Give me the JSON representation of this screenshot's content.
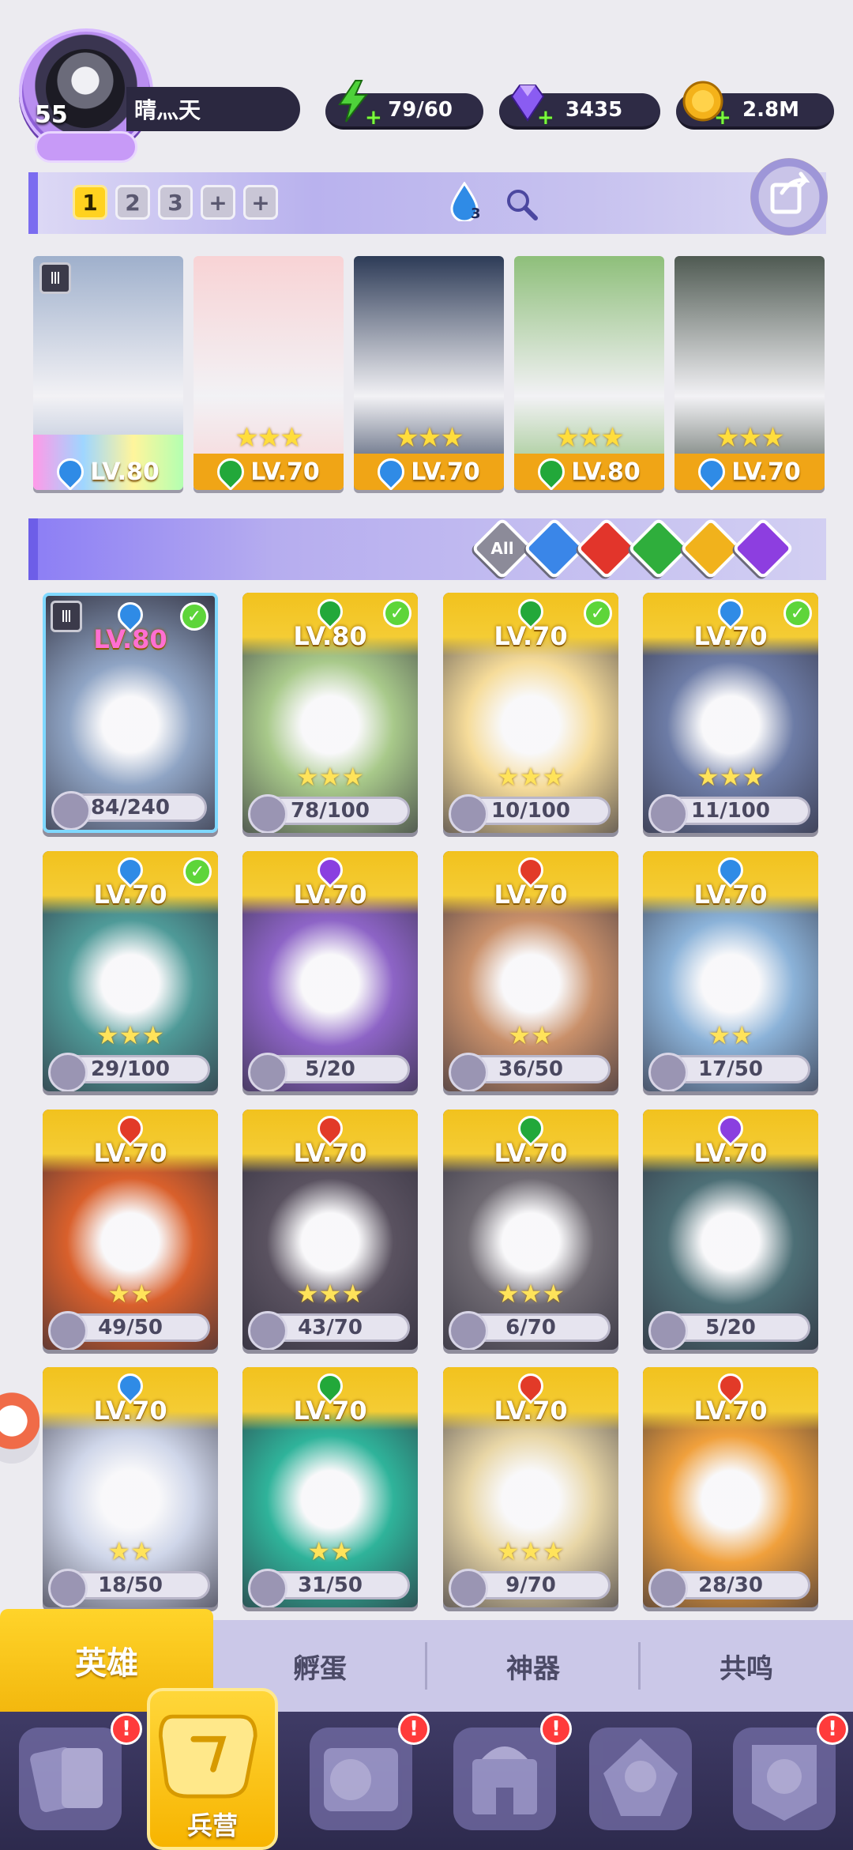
{
  "player": {
    "level": "55",
    "name": "晴灬天"
  },
  "resources": [
    {
      "name": "stamina",
      "value": "79/60",
      "icon": "lightning-icon",
      "color": "#4ed23a"
    },
    {
      "name": "gems",
      "value": "3435",
      "icon": "gem-icon",
      "color": "#8a5cf2"
    },
    {
      "name": "coins",
      "value": "2.8M",
      "icon": "coin-icon",
      "color": "#f4b21a"
    }
  ],
  "team_bar": {
    "tabs": [
      "1",
      "2",
      "3",
      "+",
      "+"
    ],
    "active_tab": "1",
    "water_count": "3"
  },
  "team_slots": [
    {
      "level": "LV.80",
      "element": "water",
      "stars": "",
      "team_mark": "Ⅲ"
    },
    {
      "level": "LV.70",
      "element": "wind",
      "stars": "★★★"
    },
    {
      "level": "LV.70",
      "element": "water",
      "stars": "★★★"
    },
    {
      "level": "LV.80",
      "element": "wind",
      "stars": "★★★"
    },
    {
      "level": "LV.70",
      "element": "water",
      "stars": "★★★"
    }
  ],
  "filters": [
    {
      "label": "All",
      "color": "#8c8b99"
    },
    {
      "label": "",
      "color": "#3a86e8"
    },
    {
      "label": "",
      "color": "#e2352b"
    },
    {
      "label": "",
      "color": "#2fae3c"
    },
    {
      "label": "",
      "color": "#f1b21c"
    },
    {
      "label": "",
      "color": "#8d3ee0"
    }
  ],
  "element_colors": {
    "water": "#2f8be6",
    "wind": "#22a83a",
    "fire": "#e23a28",
    "dark": "#8a3fe0",
    "light": "#f2b31c"
  },
  "heroes": [
    {
      "level": "LV.80",
      "element": "water",
      "shards": "84/240",
      "stars": "",
      "checked": true,
      "team_mark": "Ⅲ",
      "art": "#8fa4c4"
    },
    {
      "level": "LV.80",
      "element": "wind",
      "shards": "78/100",
      "stars": "★★★",
      "checked": true,
      "art": "#a8c98a"
    },
    {
      "level": "LV.70",
      "element": "wind",
      "shards": "10/100",
      "stars": "★★★",
      "checked": true,
      "art": "#f6dc9a"
    },
    {
      "level": "LV.70",
      "element": "water",
      "shards": "11/100",
      "stars": "★★★",
      "checked": true,
      "art": "#6d7ca6"
    },
    {
      "level": "LV.70",
      "element": "water",
      "shards": "29/100",
      "stars": "★★★",
      "checked": true,
      "art": "#4f9a98"
    },
    {
      "level": "LV.70",
      "element": "dark",
      "shards": "5/20",
      "stars": "",
      "checked": false,
      "art": "#8d64c6"
    },
    {
      "level": "LV.70",
      "element": "fire",
      "shards": "36/50",
      "stars": "★★",
      "checked": false,
      "art": "#c9906a"
    },
    {
      "level": "LV.70",
      "element": "water",
      "shards": "17/50",
      "stars": "★★",
      "checked": false,
      "art": "#8bb2d8"
    },
    {
      "level": "LV.70",
      "element": "fire",
      "shards": "49/50",
      "stars": "★★",
      "checked": false,
      "art": "#d9602c"
    },
    {
      "level": "LV.70",
      "element": "fire",
      "shards": "43/70",
      "stars": "★★★",
      "checked": false,
      "art": "#5a5260"
    },
    {
      "level": "LV.70",
      "element": "wind",
      "shards": "6/70",
      "stars": "★★★",
      "checked": false,
      "art": "#6f6a72"
    },
    {
      "level": "LV.70",
      "element": "dark",
      "shards": "5/20",
      "stars": "",
      "checked": false,
      "art": "#4d6f76"
    },
    {
      "level": "LV.70",
      "element": "water",
      "shards": "18/50",
      "stars": "★★",
      "checked": false,
      "art": "#cfd6e9"
    },
    {
      "level": "LV.70",
      "element": "wind",
      "shards": "31/50",
      "stars": "★★",
      "checked": false,
      "art": "#2fb39a"
    },
    {
      "level": "LV.70",
      "element": "fire",
      "shards": "9/70",
      "stars": "★★★",
      "checked": false,
      "art": "#e8d6a6"
    },
    {
      "level": "LV.70",
      "element": "fire",
      "shards": "28/30",
      "stars": "",
      "checked": false,
      "art": "#f0a03c"
    }
  ],
  "sub_tabs": [
    "英雄",
    "孵蛋",
    "神器",
    "共鸣"
  ],
  "active_sub_tab": "英雄",
  "nav": {
    "items": [
      {
        "name": "cards",
        "alert": "!"
      },
      {
        "name": "barracks",
        "label": "兵营"
      },
      {
        "name": "map",
        "alert": "!"
      },
      {
        "name": "castle",
        "alert": "!"
      },
      {
        "name": "guild",
        "alert": ""
      },
      {
        "name": "banner",
        "alert": "!"
      }
    ]
  }
}
